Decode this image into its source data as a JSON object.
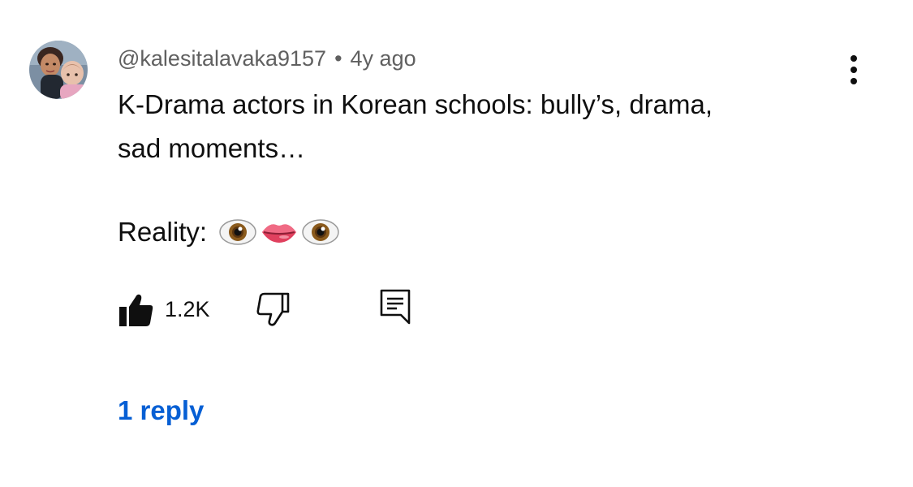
{
  "comment": {
    "author": "@kalesitalavaka9157",
    "separator": "•",
    "time": "4y ago",
    "text_line1": "K-Drama actors in Korean schools: bully’s, drama,",
    "text_line2": "sad moments…",
    "reality_label": "Reality:",
    "emojis": [
      "eye-icon",
      "lips-icon",
      "eye-icon"
    ],
    "like_count": "1.2K",
    "replies_label": "1 reply"
  },
  "icons": {
    "more": "more-vertical-icon",
    "like": "thumbs-up-filled-icon",
    "dislike": "thumbs-down-outline-icon",
    "reply": "reply-comment-icon"
  },
  "colors": {
    "text": "#0f0f0f",
    "meta": "#606060",
    "link": "#065fd4",
    "background": "#ffffff"
  }
}
